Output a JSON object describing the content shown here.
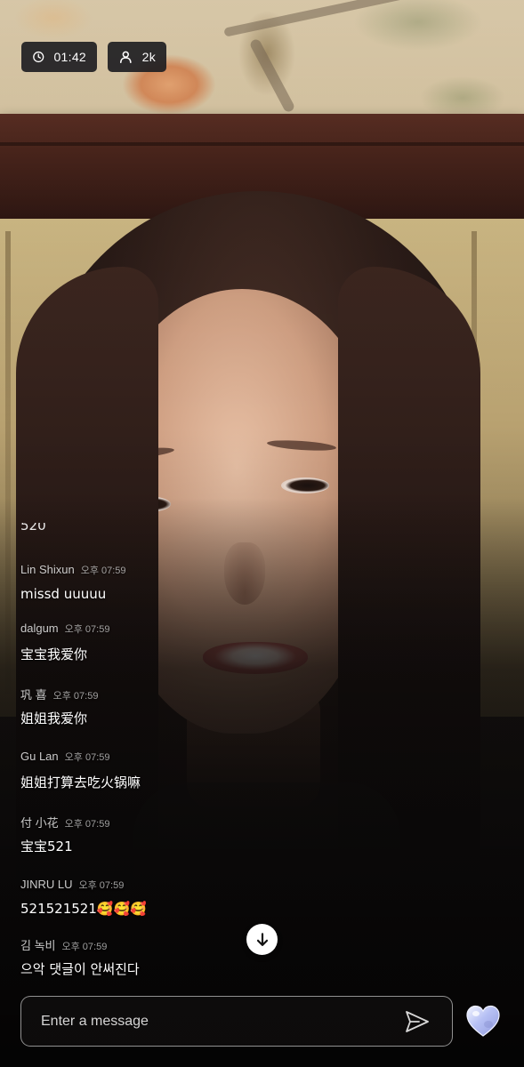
{
  "stream": {
    "elapsed_time": "01:42",
    "viewer_count": "2k"
  },
  "chat": {
    "partial_text": "520",
    "messages": [
      {
        "user": "Lin Shixun",
        "time": "오후 07:59",
        "text": "missd uuuuu"
      },
      {
        "user": "dalgum",
        "time": "오후 07:59",
        "text": "宝宝我爱你"
      },
      {
        "user": "巩 喜",
        "time": "오후 07:59",
        "text": "姐姐我爱你"
      },
      {
        "user": "Gu Lan",
        "time": "오후 07:59",
        "text": "姐姐打算去吃火锅嘛"
      },
      {
        "user": "付 小花",
        "time": "오후 07:59",
        "text": "宝宝521"
      },
      {
        "user": "JINRU LU",
        "time": "오후 07:59",
        "text": "521521521🥰🥰🥰"
      },
      {
        "user": "김 녹비",
        "time": "오후 07:59",
        "text": "으악 댓글이 안써진다"
      }
    ]
  },
  "input": {
    "placeholder": "Enter a message"
  },
  "icons": {
    "time": "clock-icon",
    "viewers": "person-icon",
    "scroll": "arrow-down-icon",
    "send": "send-icon",
    "reaction": "heart-icon"
  },
  "colors": {
    "badge_bg": "#1e1e22",
    "heart_gradient": [
      "#dfe6ff",
      "#a9b4f0",
      "#c9a6ef"
    ]
  }
}
